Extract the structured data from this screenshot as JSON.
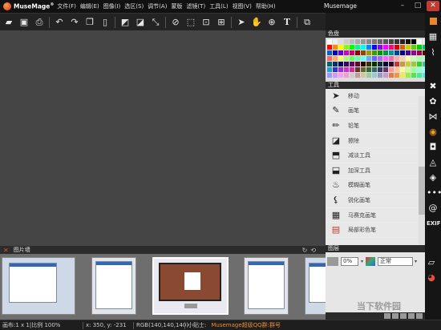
{
  "app": {
    "name": "MuseMage",
    "trademark": "®",
    "window_title": "Musemage"
  },
  "menu": [
    "文件(F)",
    "编辑(E)",
    "图像(I)",
    "选区(S)",
    "调节(A)",
    "蒙版",
    "滤镜(T)",
    "工具(L)",
    "视图(V)",
    "帮助(H)"
  ],
  "toolbar_icons": [
    "open-icon",
    "save-icon",
    "print-icon",
    "undo-icon",
    "redo-icon",
    "copy-icon",
    "paste-icon",
    "rotate-left-icon",
    "rotate-right-icon",
    "resize-icon",
    "deselect-icon",
    "select-all-icon",
    "select-inverse-icon",
    "transform-icon",
    "pointer-icon",
    "hand-icon",
    "zoom-icon",
    "text-icon",
    "layers-icon",
    "color-swap-icon"
  ],
  "panels": {
    "palette_title": "色盘",
    "tools_title": "工具",
    "layers_title": "图层",
    "filmstrip_title": "图片墙"
  },
  "tools": [
    {
      "label": "移动",
      "icon": "move-icon"
    },
    {
      "label": "画笔",
      "icon": "brush-icon"
    },
    {
      "label": "铅笔",
      "icon": "pencil-icon"
    },
    {
      "label": "擦除",
      "icon": "eraser-icon"
    },
    {
      "label": "减淡工具",
      "icon": "dodge-icon"
    },
    {
      "label": "加深工具",
      "icon": "burn-icon"
    },
    {
      "label": "模糊画笔",
      "icon": "blur-brush-icon"
    },
    {
      "label": "锐化画笔",
      "icon": "sharpen-brush-icon"
    },
    {
      "label": "马赛克画笔",
      "icon": "mosaic-brush-icon"
    },
    {
      "label": "局部彩色笔",
      "icon": "partial-color-brush-icon"
    }
  ],
  "layers": {
    "opacity": "0%",
    "blend_mode": "正常"
  },
  "status": {
    "canvas_info": "画布:1 x 1|比例 100%",
    "coords": "x: 350, y: -231",
    "rgb": "RGB(140,140,140)",
    "tip_label": "小贴士:",
    "promo": "Musemage超级QQ群:群号"
  },
  "watermark": "当下软件园",
  "side_icons": [
    "tools-icon",
    "palette-effects-icon",
    "butterfly-icon",
    "color-wheel-icon",
    "camera-icon",
    "drops-icon",
    "diamond-icon",
    "more-icon",
    "at-icon",
    "exif-icon"
  ],
  "side_labels": {
    "exif": "EXIF"
  },
  "colors": {
    "accent": "#e8862a",
    "close": "#c23b32",
    "promo": "#f08c28"
  }
}
